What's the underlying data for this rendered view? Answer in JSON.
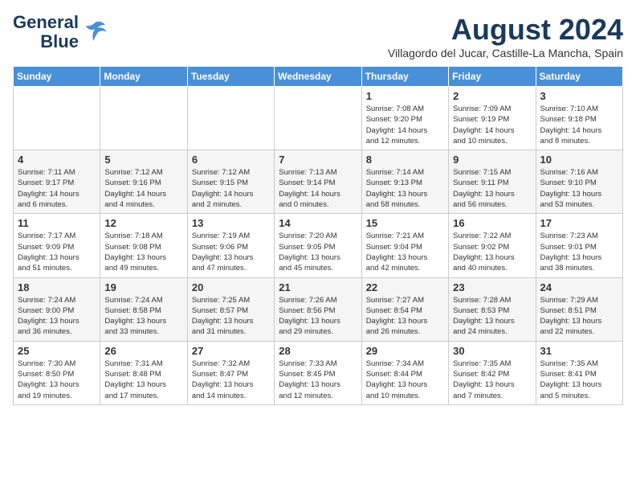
{
  "logo": {
    "line1": "General",
    "line2": "Blue"
  },
  "header": {
    "title": "August 2024",
    "subtitle": "Villagordo del Jucar, Castille-La Mancha, Spain"
  },
  "weekdays": [
    "Sunday",
    "Monday",
    "Tuesday",
    "Wednesday",
    "Thursday",
    "Friday",
    "Saturday"
  ],
  "weeks": [
    [
      {
        "day": "",
        "detail": ""
      },
      {
        "day": "",
        "detail": ""
      },
      {
        "day": "",
        "detail": ""
      },
      {
        "day": "",
        "detail": ""
      },
      {
        "day": "1",
        "detail": "Sunrise: 7:08 AM\nSunset: 9:20 PM\nDaylight: 14 hours\nand 12 minutes."
      },
      {
        "day": "2",
        "detail": "Sunrise: 7:09 AM\nSunset: 9:19 PM\nDaylight: 14 hours\nand 10 minutes."
      },
      {
        "day": "3",
        "detail": "Sunrise: 7:10 AM\nSunset: 9:18 PM\nDaylight: 14 hours\nand 8 minutes."
      }
    ],
    [
      {
        "day": "4",
        "detail": "Sunrise: 7:11 AM\nSunset: 9:17 PM\nDaylight: 14 hours\nand 6 minutes."
      },
      {
        "day": "5",
        "detail": "Sunrise: 7:12 AM\nSunset: 9:16 PM\nDaylight: 14 hours\nand 4 minutes."
      },
      {
        "day": "6",
        "detail": "Sunrise: 7:12 AM\nSunset: 9:15 PM\nDaylight: 14 hours\nand 2 minutes."
      },
      {
        "day": "7",
        "detail": "Sunrise: 7:13 AM\nSunset: 9:14 PM\nDaylight: 14 hours\nand 0 minutes."
      },
      {
        "day": "8",
        "detail": "Sunrise: 7:14 AM\nSunset: 9:13 PM\nDaylight: 13 hours\nand 58 minutes."
      },
      {
        "day": "9",
        "detail": "Sunrise: 7:15 AM\nSunset: 9:11 PM\nDaylight: 13 hours\nand 56 minutes."
      },
      {
        "day": "10",
        "detail": "Sunrise: 7:16 AM\nSunset: 9:10 PM\nDaylight: 13 hours\nand 53 minutes."
      }
    ],
    [
      {
        "day": "11",
        "detail": "Sunrise: 7:17 AM\nSunset: 9:09 PM\nDaylight: 13 hours\nand 51 minutes."
      },
      {
        "day": "12",
        "detail": "Sunrise: 7:18 AM\nSunset: 9:08 PM\nDaylight: 13 hours\nand 49 minutes."
      },
      {
        "day": "13",
        "detail": "Sunrise: 7:19 AM\nSunset: 9:06 PM\nDaylight: 13 hours\nand 47 minutes."
      },
      {
        "day": "14",
        "detail": "Sunrise: 7:20 AM\nSunset: 9:05 PM\nDaylight: 13 hours\nand 45 minutes."
      },
      {
        "day": "15",
        "detail": "Sunrise: 7:21 AM\nSunset: 9:04 PM\nDaylight: 13 hours\nand 42 minutes."
      },
      {
        "day": "16",
        "detail": "Sunrise: 7:22 AM\nSunset: 9:02 PM\nDaylight: 13 hours\nand 40 minutes."
      },
      {
        "day": "17",
        "detail": "Sunrise: 7:23 AM\nSunset: 9:01 PM\nDaylight: 13 hours\nand 38 minutes."
      }
    ],
    [
      {
        "day": "18",
        "detail": "Sunrise: 7:24 AM\nSunset: 9:00 PM\nDaylight: 13 hours\nand 36 minutes."
      },
      {
        "day": "19",
        "detail": "Sunrise: 7:24 AM\nSunset: 8:58 PM\nDaylight: 13 hours\nand 33 minutes."
      },
      {
        "day": "20",
        "detail": "Sunrise: 7:25 AM\nSunset: 8:57 PM\nDaylight: 13 hours\nand 31 minutes."
      },
      {
        "day": "21",
        "detail": "Sunrise: 7:26 AM\nSunset: 8:56 PM\nDaylight: 13 hours\nand 29 minutes."
      },
      {
        "day": "22",
        "detail": "Sunrise: 7:27 AM\nSunset: 8:54 PM\nDaylight: 13 hours\nand 26 minutes."
      },
      {
        "day": "23",
        "detail": "Sunrise: 7:28 AM\nSunset: 8:53 PM\nDaylight: 13 hours\nand 24 minutes."
      },
      {
        "day": "24",
        "detail": "Sunrise: 7:29 AM\nSunset: 8:51 PM\nDaylight: 13 hours\nand 22 minutes."
      }
    ],
    [
      {
        "day": "25",
        "detail": "Sunrise: 7:30 AM\nSunset: 8:50 PM\nDaylight: 13 hours\nand 19 minutes."
      },
      {
        "day": "26",
        "detail": "Sunrise: 7:31 AM\nSunset: 8:48 PM\nDaylight: 13 hours\nand 17 minutes."
      },
      {
        "day": "27",
        "detail": "Sunrise: 7:32 AM\nSunset: 8:47 PM\nDaylight: 13 hours\nand 14 minutes."
      },
      {
        "day": "28",
        "detail": "Sunrise: 7:33 AM\nSunset: 8:45 PM\nDaylight: 13 hours\nand 12 minutes."
      },
      {
        "day": "29",
        "detail": "Sunrise: 7:34 AM\nSunset: 8:44 PM\nDaylight: 13 hours\nand 10 minutes."
      },
      {
        "day": "30",
        "detail": "Sunrise: 7:35 AM\nSunset: 8:42 PM\nDaylight: 13 hours\nand 7 minutes."
      },
      {
        "day": "31",
        "detail": "Sunrise: 7:35 AM\nSunset: 8:41 PM\nDaylight: 13 hours\nand 5 minutes."
      }
    ]
  ]
}
